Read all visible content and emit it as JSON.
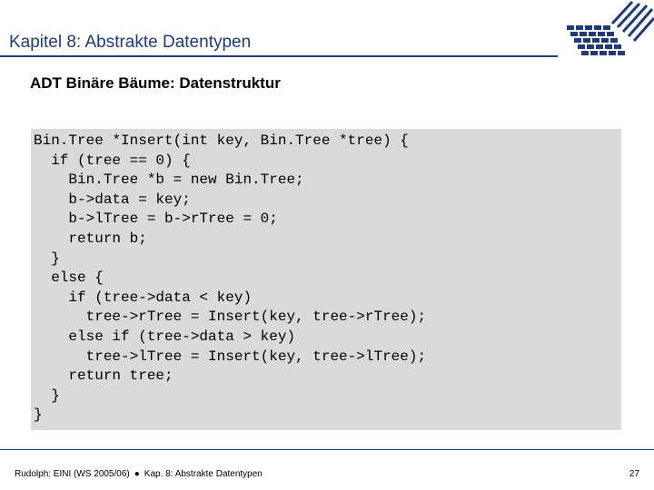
{
  "slide": {
    "title": "Kapitel 8: Abstrakte Datentypen",
    "subtitle": "ADT Binäre Bäume: Datenstruktur",
    "code_lines": [
      "Bin.Tree *Insert(int key, Bin.Tree *tree) {",
      "  if (tree == 0) {",
      "    Bin.Tree *b = new Bin.Tree;",
      "    b->data = key;",
      "    b->lTree = b->rTree = 0;",
      "    return b;",
      "  }",
      "  else {",
      "    if (tree->data < key)",
      "      tree->rTree = Insert(key, tree->rTree);",
      "    else if (tree->data > key)",
      "      tree->lTree = Insert(key, tree->lTree);",
      "    return tree;",
      "  }",
      "}"
    ]
  },
  "footer": {
    "left_text": "Rudolph: EINI (WS 2005/06)",
    "bullet": "●",
    "chapter": "Kap. 8: Abstrakte Datentypen",
    "page_number": "27"
  },
  "colors": {
    "accent": "#1f3a78",
    "code_background": "#dadada"
  },
  "logo": {
    "icon": "university-grid-logo-icon"
  }
}
